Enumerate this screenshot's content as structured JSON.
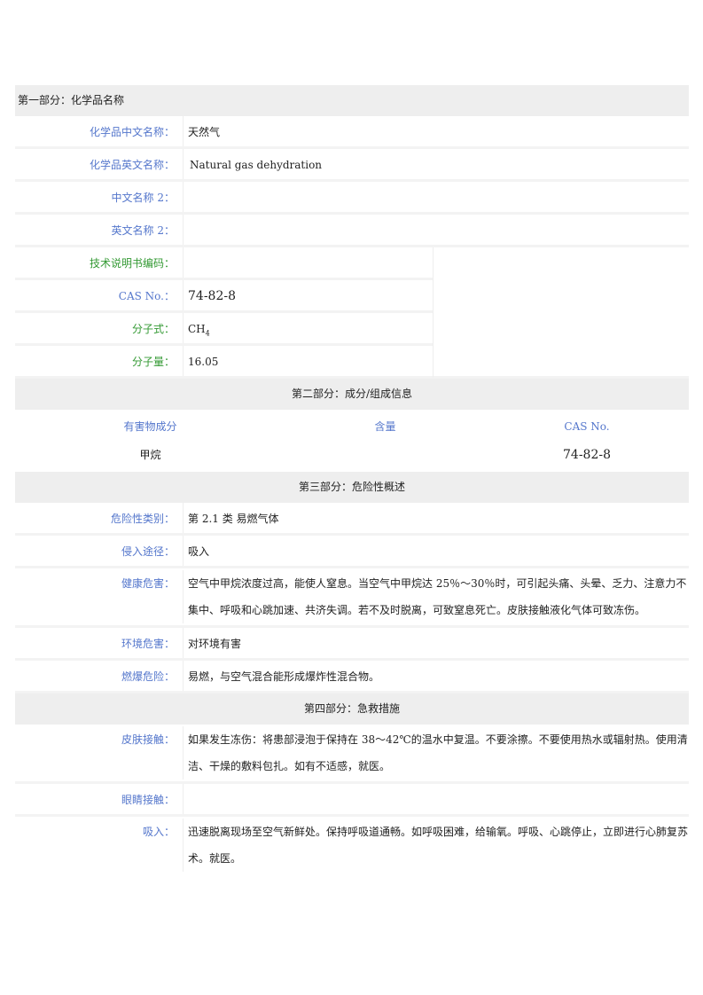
{
  "section1": {
    "title": "第一部分：化学品名称",
    "rows": [
      {
        "label": "化学品中文名称：",
        "value": "天然气"
      },
      {
        "label": "化学品英文名称：",
        "value": "Natural gas dehydration"
      },
      {
        "label": "中文名称 2：",
        "value": ""
      },
      {
        "label": "英文名称 2：",
        "value": ""
      },
      {
        "label": "技术说明书编码：",
        "value": ""
      },
      {
        "label": "CAS No.：",
        "value": "74-82-8"
      },
      {
        "label": "分子式：",
        "value": "CH",
        "sub": "4"
      },
      {
        "label": "分子量：",
        "value": "16.05"
      }
    ]
  },
  "section2": {
    "title": "第二部分：成分/组成信息",
    "headers": [
      "有害物成分",
      "含量",
      "CAS No."
    ],
    "rows": [
      [
        "甲烷",
        "",
        "74-82-8"
      ]
    ]
  },
  "section3": {
    "title": "第三部分：危险性概述",
    "rows": [
      {
        "label": "危险性类别：",
        "value": "第 2.1 类  易燃气体"
      },
      {
        "label": "侵入途径：",
        "value": "吸入"
      },
      {
        "label": "健康危害：",
        "value": "空气中甲烷浓度过高，能使人窒息。当空气中甲烷达 25％～30％时，可引起头痛、头晕、乏力、注意力不集中、呼吸和心跳加速、共济失调。若不及时脱离，可致窒息死亡。皮肤接触液化气体可致冻伤。"
      },
      {
        "label": "环境危害：",
        "value": "对环境有害"
      },
      {
        "label": "燃爆危险：",
        "value": "易燃，与空气混合能形成爆炸性混合物。"
      }
    ]
  },
  "section4": {
    "title": "第四部分：急救措施",
    "rows": [
      {
        "label": "皮肤接触：",
        "value": "如果发生冻伤：将患部浸泡于保持在 38～42℃的温水中复温。不要涂擦。不要使用热水或辐射热。使用清洁、干燥的敷料包扎。如有不适感，就医。"
      },
      {
        "label": "眼睛接触：",
        "value": ""
      },
      {
        "label": "吸入：",
        "value": "迅速脱离现场至空气新鲜处。保持呼吸道通畅。如呼吸困难，给输氧。呼吸、心跳停止，立即进行心肺复苏术。就医。"
      }
    ]
  },
  "colors": {
    "label_blue": "#5577cc",
    "label_green": "#339933",
    "section_bg": "#eeeeee"
  }
}
